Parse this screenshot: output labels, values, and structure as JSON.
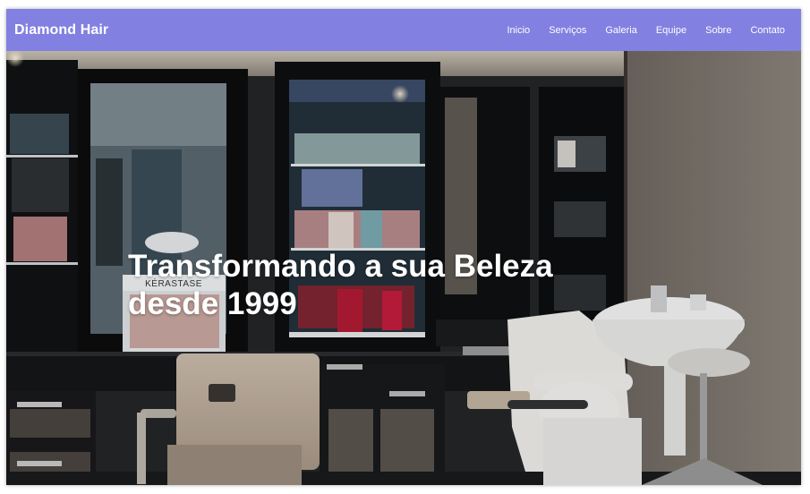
{
  "header": {
    "brand": "Diamond Hair",
    "nav": [
      {
        "label": "Inicio"
      },
      {
        "label": "Serviços"
      },
      {
        "label": "Galeria"
      },
      {
        "label": "Equipe"
      },
      {
        "label": "Sobre"
      },
      {
        "label": "Contato"
      }
    ],
    "background_color": "#8280e0"
  },
  "hero": {
    "line1": "Transformando a sua Beleza",
    "line2": "desde 1999",
    "image_description_tag": "salon-interior-photo",
    "sign_text": "KÉRASTASE"
  }
}
